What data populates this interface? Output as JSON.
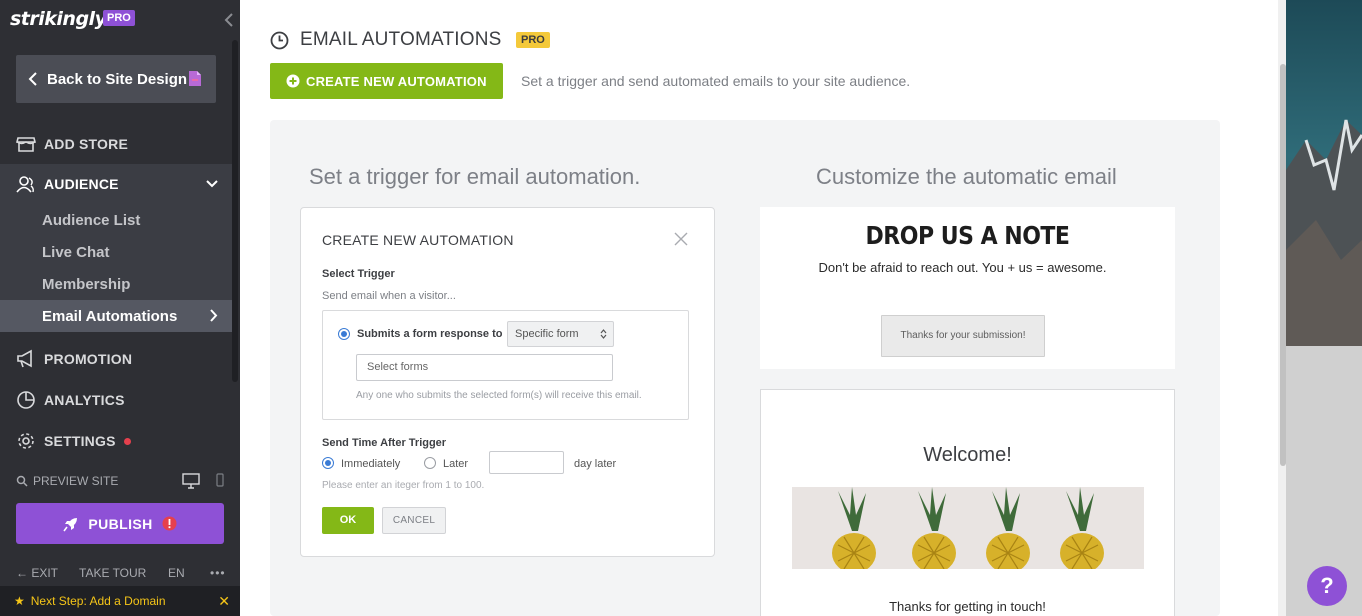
{
  "sidebar": {
    "logo": "strikingly",
    "logo_badge": "PRO",
    "back_label": "Back to Site Design",
    "nav": [
      {
        "label": "ADD STORE",
        "icon": "store-icon"
      },
      {
        "label": "AUDIENCE",
        "icon": "audience-icon"
      },
      {
        "label": "PROMOTION",
        "icon": "megaphone-icon"
      },
      {
        "label": "ANALYTICS",
        "icon": "pie-chart-icon"
      },
      {
        "label": "SETTINGS",
        "icon": "gear-icon"
      }
    ],
    "audience_sub": [
      "Audience List",
      "Live Chat",
      "Membership",
      "Email Automations"
    ],
    "preview_label": "PREVIEW SITE",
    "publish_label": "PUBLISH",
    "bottom": {
      "exit": "EXIT",
      "tour": "TAKE TOUR",
      "lang": "EN",
      "more": "•••"
    },
    "next_step": "Next Step: Add a Domain"
  },
  "main": {
    "title": "EMAIL AUTOMATIONS",
    "title_badge": "PRO",
    "create_label": "CREATE NEW AUTOMATION",
    "subtitle": "Set a trigger and send automated emails to your site audience.",
    "left_heading": "Set a trigger for email automation.",
    "right_heading": "Customize the automatic email"
  },
  "modal": {
    "title": "CREATE NEW AUTOMATION",
    "select_trigger": "Select Trigger",
    "send_when": "Send email when a visitor...",
    "option_label": "Submits a form response to",
    "select_value": "Specific form",
    "forms_placeholder": "Select forms",
    "forms_hint": "Any one who submits the selected form(s) will receive this email.",
    "send_time_label": "Send Time After Trigger",
    "immediately": "Immediately",
    "later": "Later",
    "day_later": "day later",
    "integer_hint": "Please enter an iteger  from 1 to 100.",
    "ok": "OK",
    "cancel": "CANCEL"
  },
  "preview": {
    "card1_title": "DROP US A NOTE",
    "card1_text": "Don't be afraid to reach out. You + us = awesome.",
    "card1_button": "Thanks for your submission!",
    "card2_title": "Welcome!",
    "card2_text": "Thanks for getting in touch!"
  },
  "help_label": "?",
  "colors": {
    "sidebar_bg": "#2e2f34",
    "accent_purple": "#8e51d6",
    "accent_green": "#84b817",
    "pro_yellow": "#f4c93a",
    "alert_red": "#e5404d"
  }
}
